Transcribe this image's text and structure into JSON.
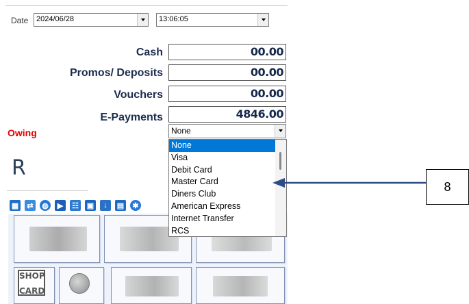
{
  "header": {
    "date_label": "Date",
    "date_value": "2024/06/28",
    "time_value": "13:06:05"
  },
  "payments": [
    {
      "label": "Cash",
      "value": "00.00"
    },
    {
      "label": "Promos/ Deposits",
      "value": "00.00"
    },
    {
      "label": "Vouchers",
      "value": "00.00"
    },
    {
      "label": "E-Payments",
      "value": "4846.00"
    }
  ],
  "owing_label": "Owing",
  "currency_symbol": "R",
  "epayment_type": {
    "selected": "None",
    "options": [
      "None",
      "Visa",
      "Debit Card",
      "Master Card",
      "Diners Club",
      "American Express",
      "Internet Transfer",
      "RCS"
    ]
  },
  "toolbar_icons": [
    "grid-icon",
    "exchange-icon",
    "globe-icon",
    "fast-forward-icon",
    "people-icon",
    "save-icon",
    "download-icon",
    "calendar-icon",
    "gear-icon"
  ],
  "tender_tiles": {
    "shop_card_text_line1": "SHOP",
    "shop_card_text_line2": "CARD"
  },
  "annotation": {
    "callout_number": "8",
    "arrow_color": "#2e4d86"
  }
}
